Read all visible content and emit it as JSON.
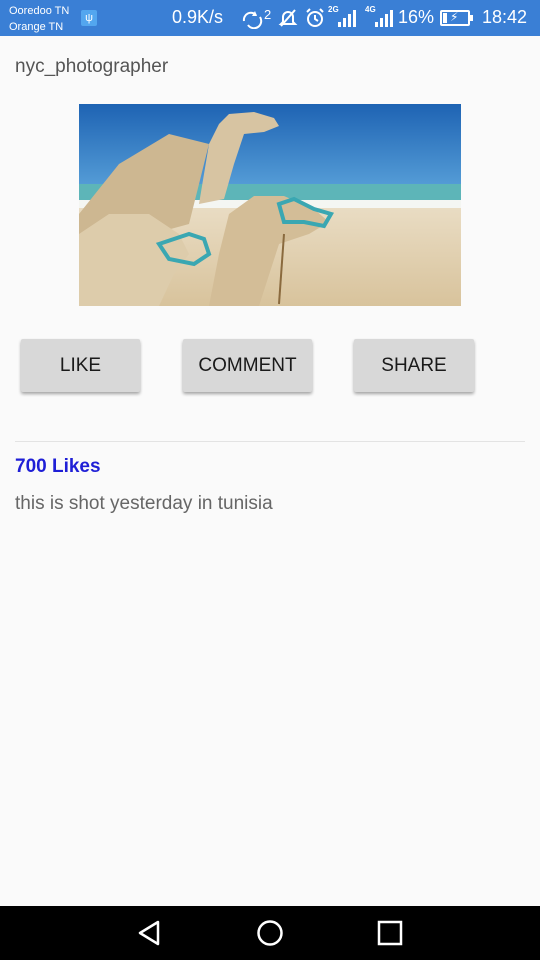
{
  "status_bar": {
    "carrier_1": "Ooredoo TN",
    "carrier_2": "Orange TN",
    "net_speed": "0.9K/s",
    "sync_badge": "2",
    "sig_tag_a": "2G",
    "sig_tag_b": "4G",
    "battery_percent": "16%",
    "battery_level": 0.16,
    "time": "18:42",
    "color": "#3a7fd5",
    "icons": [
      "usb-icon",
      "sync-icon",
      "silent-icon",
      "alarm-icon",
      "signal-2g-icon",
      "signal-4g-icon",
      "battery-charging-icon"
    ]
  },
  "post": {
    "username": "nyc_photographer",
    "photo_subject": "camels-on-beach",
    "likes": "700 Likes",
    "likes_color": "#1f1fd6",
    "caption": "this is shot yesterday in tunisia"
  },
  "actions": {
    "like": "LIKE",
    "comment": "COMMENT",
    "share": "SHARE"
  },
  "nav": {
    "icons": [
      "back-icon",
      "home-icon",
      "recents-icon"
    ]
  }
}
